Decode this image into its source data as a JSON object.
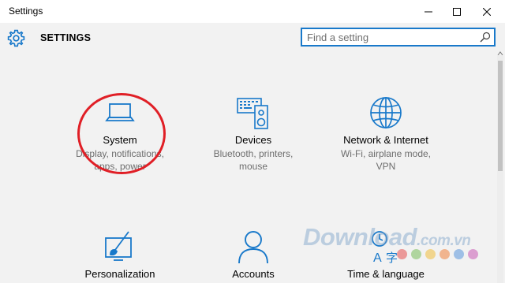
{
  "window": {
    "title": "Settings",
    "minimize_icon": "minimize-icon",
    "maximize_icon": "maximize-icon",
    "close_icon": "close-icon"
  },
  "header": {
    "title": "SETTINGS",
    "icon": "gear-icon"
  },
  "search": {
    "placeholder": "Find a setting",
    "value": "",
    "icon": "search-icon"
  },
  "tiles": [
    {
      "name": "System",
      "description": [
        "Display, notifications,",
        "apps, power"
      ],
      "icon": "laptop-icon"
    },
    {
      "name": "Devices",
      "description": [
        "Bluetooth, printers,",
        "mouse"
      ],
      "icon": "keyboard-speaker-icon"
    },
    {
      "name": "Network & Internet",
      "description": [
        "Wi-Fi, airplane mode,",
        "VPN"
      ],
      "icon": "globe-icon"
    },
    {
      "name": "Personalization",
      "description": [],
      "icon": "paint-icon"
    },
    {
      "name": "Accounts",
      "description": [],
      "icon": "person-icon"
    },
    {
      "name": "Time & language",
      "description": [],
      "icon": "time-language-icon"
    }
  ],
  "watermark": {
    "main": "Download",
    "domain": ".com.vn"
  },
  "colors": {
    "accent": "#1979ca",
    "highlight_circle": "#e01f26",
    "background": "#f2f2f2"
  }
}
